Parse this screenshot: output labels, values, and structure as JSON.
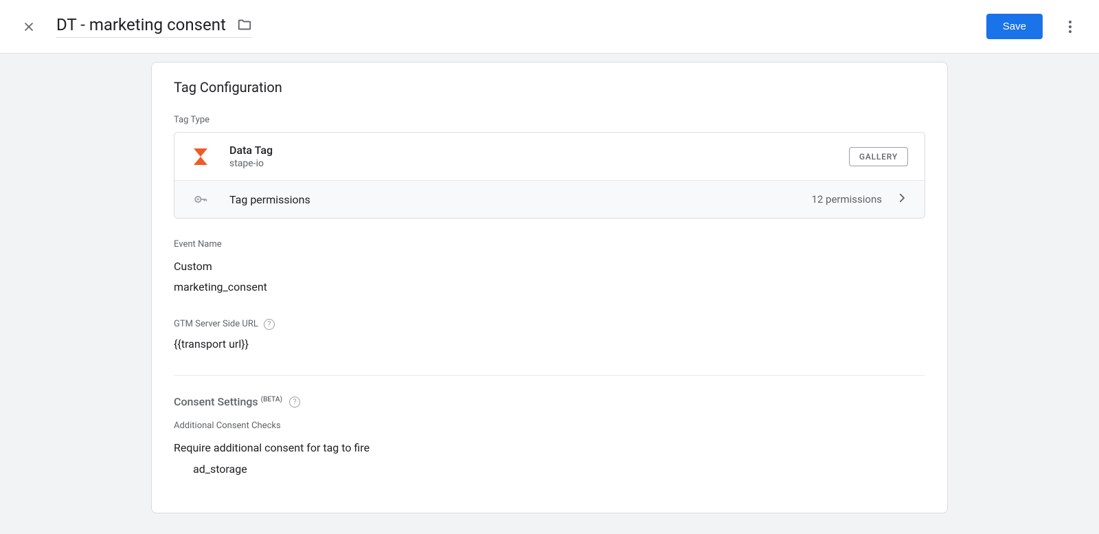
{
  "header": {
    "title": "DT - marketing consent",
    "save_label": "Save"
  },
  "card": {
    "title": "Tag Configuration",
    "tag_type": {
      "label": "Tag Type",
      "name": "Data Tag",
      "vendor": "stape-io",
      "gallery_label": "GALLERY",
      "permissions_label": "Tag permissions",
      "permissions_count": "12 permissions"
    },
    "event_name": {
      "label": "Event Name",
      "value1": "Custom",
      "value2": "marketing_consent"
    },
    "server_url": {
      "label": "GTM Server Side URL",
      "value": "{{transport url}}"
    },
    "consent": {
      "heading": "Consent Settings",
      "beta": "(BETA)",
      "checks_label": "Additional Consent Checks",
      "checks_value": "Require additional consent for tag to fire",
      "storage": "ad_storage"
    }
  }
}
